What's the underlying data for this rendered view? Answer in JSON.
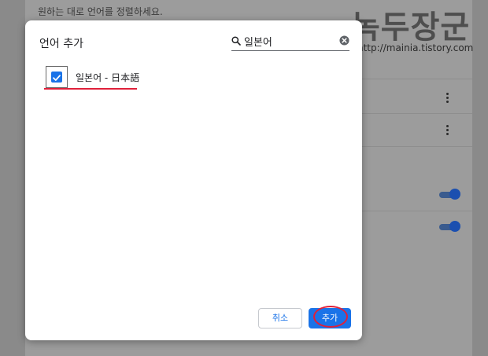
{
  "background_page": {
    "hint_text": "원하는 대로 언어를 정렬하세요.",
    "bottom_text": "",
    "menu_icon": "more-vert-icon",
    "toggle_colors": {
      "track": "#3a5b8e",
      "knob": "#1b4fb0"
    }
  },
  "watermark": {
    "title": "녹두장군",
    "url": "http://mainia.tistory.com"
  },
  "dialog": {
    "title": "언어 추가",
    "search": {
      "value": "일본어",
      "placeholder": "",
      "search_icon": "search-icon",
      "clear_icon": "clear-icon"
    },
    "languages": [
      {
        "label": "일본어 - 日本語",
        "checked": true
      }
    ],
    "buttons": {
      "cancel_label": "취소",
      "add_label": "추가"
    },
    "colors": {
      "accent": "#1a73e8",
      "annotation": "#e0203a"
    }
  }
}
